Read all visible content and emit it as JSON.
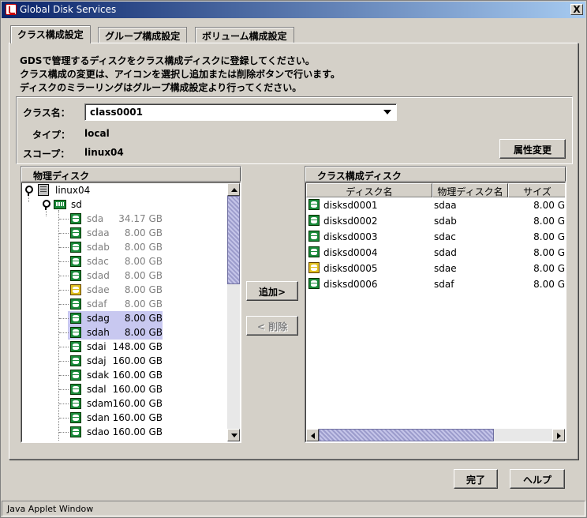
{
  "window": {
    "title": "Global Disk Services",
    "close_label": "X",
    "status": "Java Applet Window"
  },
  "tabs": [
    {
      "label": "クラス構成設定",
      "active": true
    },
    {
      "label": "グループ構成設定",
      "active": false
    },
    {
      "label": "ボリューム構成設定",
      "active": false
    }
  ],
  "intro": [
    "GDSで管理するディスクをクラス構成ディスクに登録してください。",
    "クラス構成の変更は、アイコンを選択し追加または削除ボタンで行います。",
    "ディスクのミラーリングはグループ構成設定より行ってください。"
  ],
  "class_info": {
    "class_label": "クラス名：",
    "class_value": "class0001",
    "type_label": "タイプ：",
    "type_value": "local",
    "scope_label": "スコープ：",
    "scope_value": "linux04",
    "attr_button": "属性変更"
  },
  "physical": {
    "header": "物理ディスク",
    "host": "linux04",
    "sd": "sd",
    "disks": [
      {
        "name": "sda",
        "size": "34.17 GB",
        "state": "dim",
        "icon": "disk-icon"
      },
      {
        "name": "sdaa",
        "size": "8.00 GB",
        "state": "dim",
        "icon": "disk-icon"
      },
      {
        "name": "sdab",
        "size": "8.00 GB",
        "state": "dim",
        "icon": "disk-icon"
      },
      {
        "name": "sdac",
        "size": "8.00 GB",
        "state": "dim",
        "icon": "disk-icon"
      },
      {
        "name": "sdad",
        "size": "8.00 GB",
        "state": "dim",
        "icon": "disk-icon"
      },
      {
        "name": "sdae",
        "size": "8.00 GB",
        "state": "dim",
        "icon": "disk-warn-icon"
      },
      {
        "name": "sdaf",
        "size": "8.00 GB",
        "state": "dim",
        "icon": "disk-icon"
      },
      {
        "name": "sdag",
        "size": "8.00 GB",
        "state": "selected",
        "icon": "disk-icon"
      },
      {
        "name": "sdah",
        "size": "8.00 GB",
        "state": "selected",
        "icon": "disk-icon"
      },
      {
        "name": "sdai",
        "size": "148.00 GB",
        "state": "normal",
        "icon": "disk-icon"
      },
      {
        "name": "sdaj",
        "size": "160.00 GB",
        "state": "normal",
        "icon": "disk-icon"
      },
      {
        "name": "sdak",
        "size": "160.00 GB",
        "state": "normal",
        "icon": "disk-icon"
      },
      {
        "name": "sdal",
        "size": "160.00 GB",
        "state": "normal",
        "icon": "disk-icon"
      },
      {
        "name": "sdam",
        "size": "160.00 GB",
        "state": "normal",
        "icon": "disk-icon"
      },
      {
        "name": "sdan",
        "size": "160.00 GB",
        "state": "normal",
        "icon": "disk-icon"
      },
      {
        "name": "sdao",
        "size": "160.00 GB",
        "state": "normal",
        "icon": "disk-icon"
      }
    ]
  },
  "actions": {
    "add": "追加>",
    "remove": "< 削除"
  },
  "class_disks": {
    "header": "クラス構成ディスク",
    "columns": [
      "ディスク名",
      "物理ディスク名",
      "サイズ"
    ],
    "rows": [
      {
        "name": "disksd0001",
        "physical": "sdaa",
        "size": "8.00 G",
        "icon": "disk-icon"
      },
      {
        "name": "disksd0002",
        "physical": "sdab",
        "size": "8.00 G",
        "icon": "disk-icon"
      },
      {
        "name": "disksd0003",
        "physical": "sdac",
        "size": "8.00 G",
        "icon": "disk-icon"
      },
      {
        "name": "disksd0004",
        "physical": "sdad",
        "size": "8.00 G",
        "icon": "disk-icon"
      },
      {
        "name": "disksd0005",
        "physical": "sdae",
        "size": "8.00 G",
        "icon": "disk-warn-icon"
      },
      {
        "name": "disksd0006",
        "physical": "sdaf",
        "size": "8.00 G",
        "icon": "disk-icon"
      }
    ]
  },
  "footer": {
    "done": "完了",
    "help": "ヘルプ"
  }
}
